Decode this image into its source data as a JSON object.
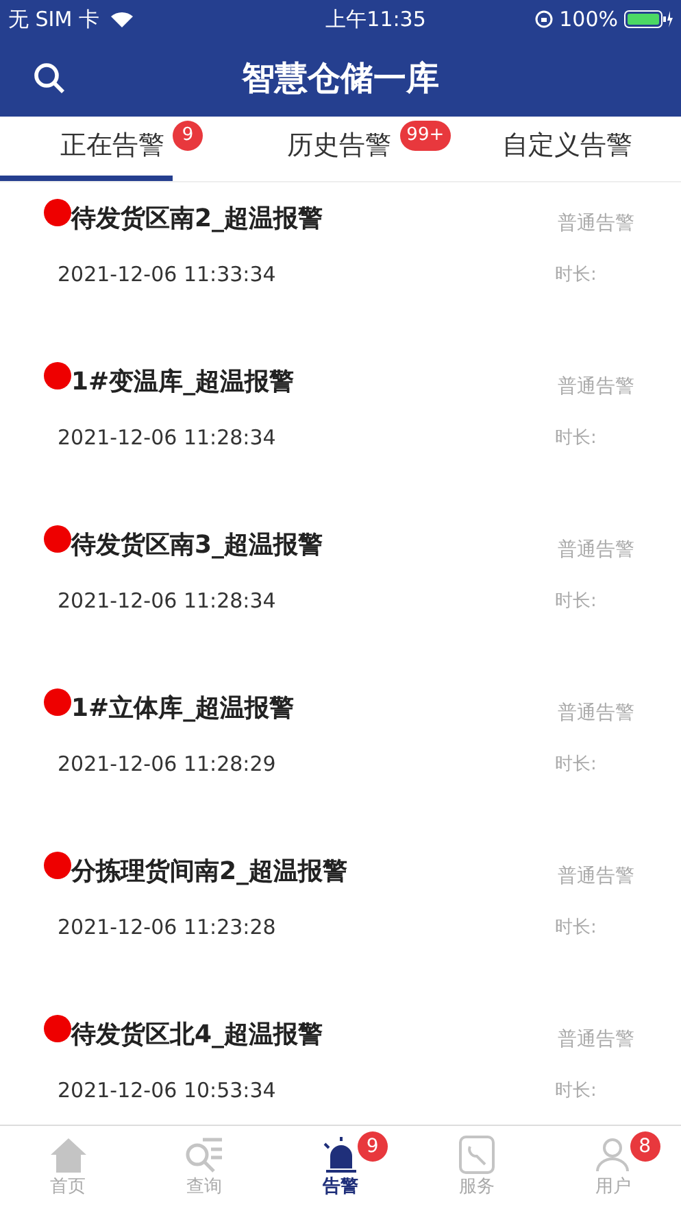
{
  "status_bar": {
    "carrier": "无 SIM 卡",
    "time": "上午11:35",
    "battery": "100%"
  },
  "header": {
    "title": "智慧仓储一库"
  },
  "tabs": [
    {
      "label": "正在告警",
      "badge": "9",
      "selected": true
    },
    {
      "label": "历史告警",
      "badge": "99+",
      "selected": false
    },
    {
      "label": "自定义告警",
      "selected": false
    }
  ],
  "alarms": [
    {
      "name": "待发货区南2_超温报警",
      "level": "普通告警",
      "time": "2021-12-06 11:33:34",
      "duration": "时长:",
      "color": "#ee0000"
    },
    {
      "name": "1#变温库_超温报警",
      "level": "普通告警",
      "time": "2021-12-06 11:28:34",
      "duration": "时长:",
      "color": "#ee0000"
    },
    {
      "name": "待发货区南3_超温报警",
      "level": "普通告警",
      "time": "2021-12-06 11:28:34",
      "duration": "时长:",
      "color": "#ee0000"
    },
    {
      "name": "1#立体库_超温报警",
      "level": "普通告警",
      "time": "2021-12-06 11:28:29",
      "duration": "时长:",
      "color": "#ee0000"
    },
    {
      "name": "分拣理货间南2_超温报警",
      "level": "普通告警",
      "time": "2021-12-06 11:23:28",
      "duration": "时长:",
      "color": "#ee0000"
    },
    {
      "name": "待发货区北4_超温报警",
      "level": "普通告警",
      "time": "2021-12-06 10:53:34",
      "duration": "时长:",
      "color": "#ee0000"
    }
  ],
  "bottom_nav": [
    {
      "kind": "home",
      "label": "首页",
      "selected": false
    },
    {
      "kind": "query",
      "label": "查询",
      "selected": false
    },
    {
      "kind": "alarm",
      "label": "告警",
      "badge": "9",
      "selected": true
    },
    {
      "kind": "service",
      "label": "服务",
      "selected": false
    },
    {
      "kind": "user",
      "label": "用户",
      "badge": "8",
      "selected": false
    }
  ]
}
